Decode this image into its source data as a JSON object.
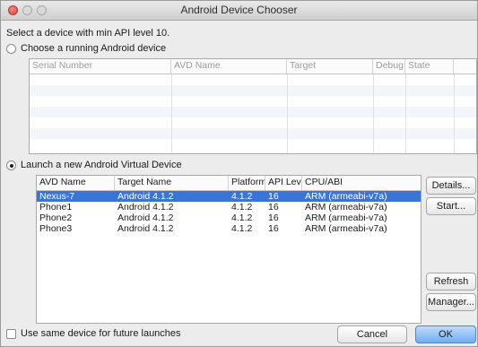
{
  "window": {
    "title": "Android Device Chooser"
  },
  "subtitle": "Select a device with min API level 10.",
  "running_device": {
    "radio_label": "Choose a running Android device",
    "columns": [
      "Serial Number",
      "AVD Name",
      "Target",
      "Debug",
      "State"
    ]
  },
  "avd": {
    "radio_label": "Launch a new Android Virtual Device",
    "columns": [
      "AVD Name",
      "Target Name",
      "Platform",
      "API Leve",
      "CPU/ABI"
    ],
    "rows": [
      {
        "avd_name": "Nexus-7",
        "target_name": "Android 4.1.2",
        "platform": "4.1.2",
        "api": "16",
        "cpu": "ARM (armeabi-v7a)"
      },
      {
        "avd_name": "Phone1",
        "target_name": "Android 4.1.2",
        "platform": "4.1.2",
        "api": "16",
        "cpu": "ARM (armeabi-v7a)"
      },
      {
        "avd_name": "Phone2",
        "target_name": "Android 4.1.2",
        "platform": "4.1.2",
        "api": "16",
        "cpu": "ARM (armeabi-v7a)"
      },
      {
        "avd_name": "Phone3",
        "target_name": "Android 4.1.2",
        "platform": "4.1.2",
        "api": "16",
        "cpu": "ARM (armeabi-v7a)"
      }
    ],
    "buttons": {
      "details": "Details...",
      "start": "Start...",
      "refresh": "Refresh",
      "manager": "Manager..."
    }
  },
  "footer": {
    "checkbox_label": "Use same device for future launches",
    "cancel": "Cancel",
    "ok": "OK"
  }
}
